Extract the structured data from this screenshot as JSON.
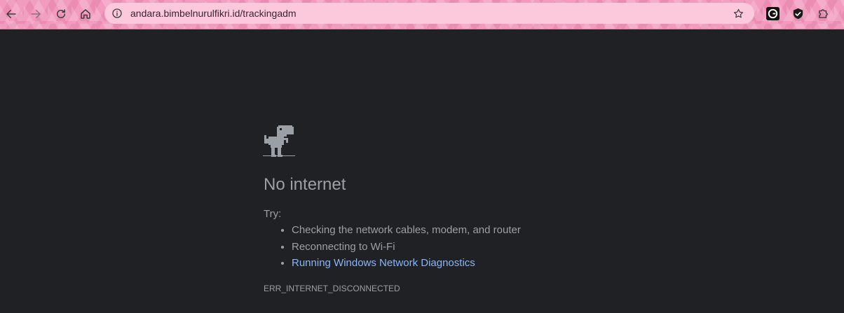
{
  "browser": {
    "address_url": "andara.bimbelnurulfikri.id/trackingadm",
    "accent_color": "#f29bbe",
    "icons": {
      "back": "arrow-left-icon",
      "forward": "arrow-right-icon",
      "reload": "reload-icon",
      "home": "home-icon",
      "site_info": "info-icon",
      "bookmark": "star-icon",
      "extension_1": "grammarly-icon",
      "extension_2": "shield-icon",
      "extensions_menu": "puzzle-icon"
    }
  },
  "error_page": {
    "title": "No internet",
    "try_label": "Try:",
    "suggestions": [
      {
        "text": "Checking the network cables, modem, and router",
        "is_link": false
      },
      {
        "text": "Reconnecting to Wi-Fi",
        "is_link": false
      },
      {
        "text": "Running Windows Network Diagnostics",
        "is_link": true
      }
    ],
    "error_code": "ERR_INTERNET_DISCONNECTED",
    "colors": {
      "background": "#202124",
      "text": "#9aa0a6",
      "link": "#8ab4f8"
    }
  }
}
